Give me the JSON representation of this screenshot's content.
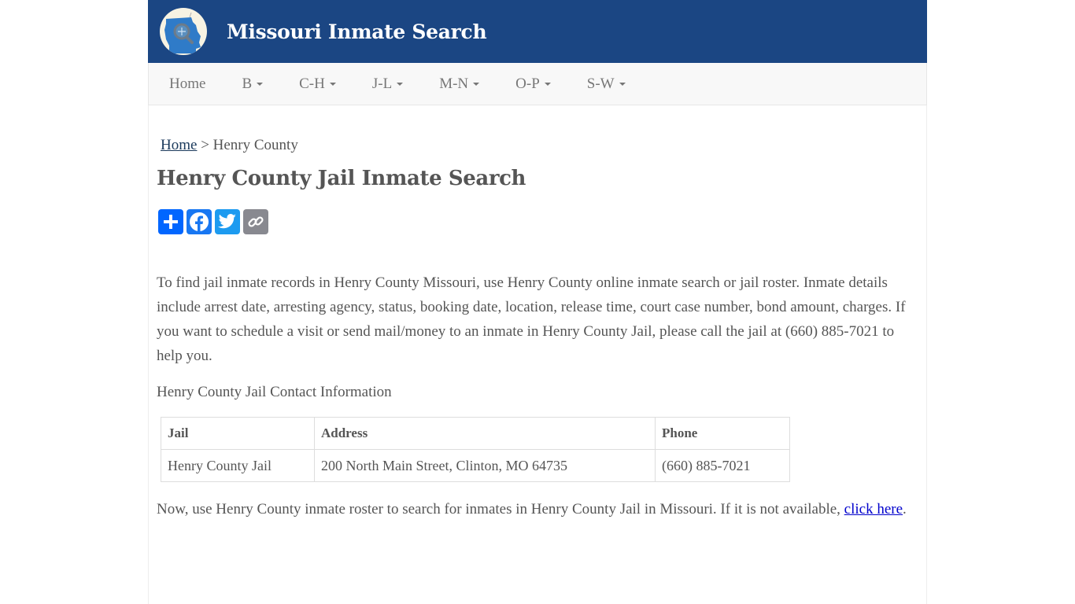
{
  "header": {
    "site_title": "Missouri Inmate Search",
    "logo_icon": "missouri-map-magnifier-icon"
  },
  "nav": {
    "items": [
      {
        "label": "Home",
        "dropdown": false
      },
      {
        "label": "B",
        "dropdown": true
      },
      {
        "label": "C-H",
        "dropdown": true
      },
      {
        "label": "J-L",
        "dropdown": true
      },
      {
        "label": "M-N",
        "dropdown": true
      },
      {
        "label": "O-P",
        "dropdown": true
      },
      {
        "label": "S-W",
        "dropdown": true
      }
    ]
  },
  "breadcrumb": {
    "home": "Home",
    "separator": " > ",
    "current": "Henry County"
  },
  "page_title": "Henry County Jail Inmate Search",
  "share": {
    "buttons": [
      {
        "name": "share",
        "icon": "plus-icon",
        "color": "#0166ff"
      },
      {
        "name": "facebook",
        "icon": "facebook-icon",
        "color": "#1877f2"
      },
      {
        "name": "twitter",
        "icon": "twitter-icon",
        "color": "#1d9bf0"
      },
      {
        "name": "copy-link",
        "icon": "link-icon",
        "color": "#888990"
      }
    ]
  },
  "intro": "To find jail inmate records in Henry County Missouri, use Henry County online inmate search or jail roster. Inmate details include arrest date, arresting agency, status, booking date, location, release time, court case number, bond amount, charges. If you want to schedule a visit or send mail/money to an inmate in Henry County Jail, please call the jail at (660) 885-7021 to help you.",
  "contact_heading": "Henry County Jail Contact Information",
  "contact_table": {
    "headers": [
      "Jail",
      "Address",
      "Phone"
    ],
    "rows": [
      [
        "Henry County Jail",
        "200 North Main Street, Clinton, MO 64735",
        "(660) 885-7021"
      ]
    ]
  },
  "roster": {
    "text": "Now, use Henry County inmate roster to search for inmates in Henry County Jail in Missouri. If it is not available, ",
    "link": "click here",
    "suffix": "."
  },
  "colors": {
    "header_bg": "#1b4683",
    "nav_bg": "#f8f8f8",
    "link": "#0000cc"
  }
}
